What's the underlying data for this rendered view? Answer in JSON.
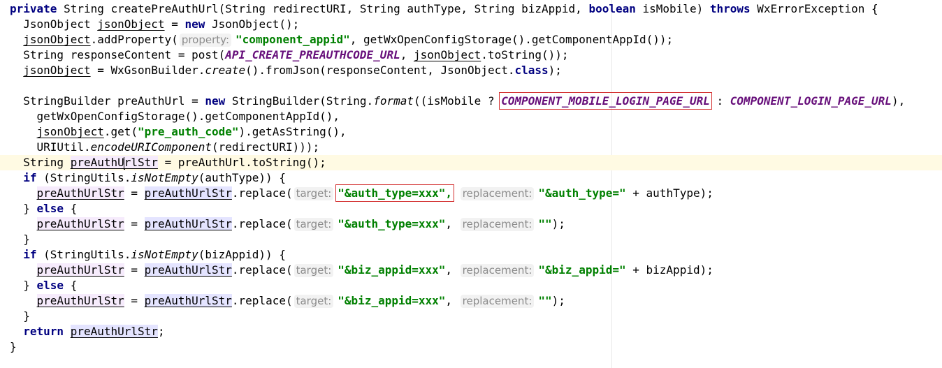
{
  "editor": {
    "lines": [
      {
        "indent": "",
        "segments": [
          {
            "t": "private",
            "c": "kw"
          },
          {
            "t": " String createPreAuthUrl(String redirectURI, String authType, String bizAppid, ",
            "c": "plain"
          },
          {
            "t": "boolean",
            "c": "kw"
          },
          {
            "t": " isMobile) ",
            "c": "plain"
          },
          {
            "t": "throws",
            "c": "kw"
          },
          {
            "t": " WxErrorException {",
            "c": "plain"
          }
        ]
      },
      {
        "indent": "  ",
        "segments": [
          {
            "t": "JsonObject ",
            "c": "plain"
          },
          {
            "t": "jsonObject",
            "c": "var-u"
          },
          {
            "t": " = ",
            "c": "plain"
          },
          {
            "t": "new",
            "c": "kw"
          },
          {
            "t": " JsonObject();",
            "c": "plain"
          }
        ]
      },
      {
        "indent": "  ",
        "segments": [
          {
            "t": "jsonObject",
            "c": "var-u"
          },
          {
            "t": ".addProperty(",
            "c": "plain"
          },
          {
            "t": "property:",
            "c": "hint"
          },
          {
            "t": "\"component_appid\"",
            "c": "str"
          },
          {
            "t": ", getWxOpenConfigStorage().getComponentAppId());",
            "c": "plain"
          }
        ]
      },
      {
        "indent": "  ",
        "segments": [
          {
            "t": "String responseContent = post(",
            "c": "plain"
          },
          {
            "t": "API_CREATE_PREAUTHCODE_URL",
            "c": "const"
          },
          {
            "t": ", ",
            "c": "plain"
          },
          {
            "t": "jsonObject",
            "c": "var-u"
          },
          {
            "t": ".toString());",
            "c": "plain"
          }
        ]
      },
      {
        "indent": "  ",
        "segments": [
          {
            "t": "jsonObject",
            "c": "var-u"
          },
          {
            "t": " = WxGsonBuilder.",
            "c": "plain"
          },
          {
            "t": "create",
            "c": "static"
          },
          {
            "t": "().fromJson(responseContent, JsonObject.",
            "c": "plain"
          },
          {
            "t": "class",
            "c": "kw"
          },
          {
            "t": ");",
            "c": "plain"
          }
        ]
      },
      {
        "indent": "",
        "segments": []
      },
      {
        "indent": "  ",
        "segments": [
          {
            "t": "StringBuilder preAuthUrl = ",
            "c": "plain"
          },
          {
            "t": "new",
            "c": "kw"
          },
          {
            "t": " StringBuilder(String.",
            "c": "plain"
          },
          {
            "t": "format",
            "c": "static"
          },
          {
            "t": "((isMobile ? ",
            "c": "plain"
          },
          {
            "t": "COMPONENT_MOBILE_LOGIN_PAGE_URL",
            "c": "const hl-box"
          },
          {
            "t": " : ",
            "c": "plain"
          },
          {
            "t": "COMPONENT_LOGIN_PAGE_URL",
            "c": "const"
          },
          {
            "t": "),",
            "c": "plain"
          }
        ]
      },
      {
        "indent": "    ",
        "segments": [
          {
            "t": "getWxOpenConfigStorage().getComponentAppId(),",
            "c": "plain"
          }
        ]
      },
      {
        "indent": "    ",
        "segments": [
          {
            "t": "jsonObject",
            "c": "var-u"
          },
          {
            "t": ".get(",
            "c": "plain"
          },
          {
            "t": "\"pre_auth_code\"",
            "c": "str"
          },
          {
            "t": ").getAsString(),",
            "c": "plain"
          }
        ]
      },
      {
        "indent": "    ",
        "segments": [
          {
            "t": "URIUtil.",
            "c": "plain"
          },
          {
            "t": "encodeURIComponent",
            "c": "static"
          },
          {
            "t": "(redirectURI)));",
            "c": "plain"
          }
        ]
      },
      {
        "indent": "  ",
        "current": true,
        "segments": [
          {
            "t": "String ",
            "c": "plain"
          },
          {
            "t": "preAuthU",
            "c": "var-u write"
          },
          {
            "t": "",
            "c": "caret"
          },
          {
            "t": "rlStr",
            "c": "var-u write"
          },
          {
            "t": " = preAuthUrl.toString();",
            "c": "plain"
          }
        ]
      },
      {
        "indent": "  ",
        "segments": [
          {
            "t": "if",
            "c": "kw"
          },
          {
            "t": " (StringUtils.",
            "c": "plain"
          },
          {
            "t": "isNotEmpty",
            "c": "static"
          },
          {
            "t": "(authType)) {",
            "c": "plain"
          }
        ]
      },
      {
        "indent": "    ",
        "segments": [
          {
            "t": "preAuthUrlStr",
            "c": "var-u write"
          },
          {
            "t": " = ",
            "c": "plain"
          },
          {
            "t": "preAuthUrlStr",
            "c": "var-u usage"
          },
          {
            "t": ".replace(",
            "c": "plain"
          },
          {
            "t": "target:",
            "c": "hint"
          },
          {
            "t": "\"&auth_type=xxx\",",
            "c": "str hl-box"
          },
          {
            "t": " ",
            "c": "plain"
          },
          {
            "t": "replacement:",
            "c": "hint"
          },
          {
            "t": "\"&auth_type=\"",
            "c": "str"
          },
          {
            "t": " + authType);",
            "c": "plain"
          }
        ]
      },
      {
        "indent": "  ",
        "segments": [
          {
            "t": "} ",
            "c": "plain"
          },
          {
            "t": "else",
            "c": "kw"
          },
          {
            "t": " {",
            "c": "plain"
          }
        ]
      },
      {
        "indent": "    ",
        "segments": [
          {
            "t": "preAuthUrlStr",
            "c": "var-u write"
          },
          {
            "t": " = ",
            "c": "plain"
          },
          {
            "t": "preAuthUrlStr",
            "c": "var-u usage"
          },
          {
            "t": ".replace(",
            "c": "plain"
          },
          {
            "t": "target:",
            "c": "hint"
          },
          {
            "t": "\"&auth_type=xxx\"",
            "c": "str"
          },
          {
            "t": ", ",
            "c": "plain"
          },
          {
            "t": "replacement:",
            "c": "hint"
          },
          {
            "t": "\"\"",
            "c": "str"
          },
          {
            "t": ");",
            "c": "plain"
          }
        ]
      },
      {
        "indent": "  ",
        "segments": [
          {
            "t": "}",
            "c": "plain"
          }
        ]
      },
      {
        "indent": "  ",
        "segments": [
          {
            "t": "if",
            "c": "kw"
          },
          {
            "t": " (StringUtils.",
            "c": "plain"
          },
          {
            "t": "isNotEmpty",
            "c": "static"
          },
          {
            "t": "(bizAppid)) {",
            "c": "plain"
          }
        ]
      },
      {
        "indent": "    ",
        "segments": [
          {
            "t": "preAuthUrlStr",
            "c": "var-u write"
          },
          {
            "t": " = ",
            "c": "plain"
          },
          {
            "t": "preAuthUrlStr",
            "c": "var-u usage"
          },
          {
            "t": ".replace(",
            "c": "plain"
          },
          {
            "t": "target:",
            "c": "hint"
          },
          {
            "t": "\"&biz_appid=xxx\"",
            "c": "str"
          },
          {
            "t": ", ",
            "c": "plain"
          },
          {
            "t": "replacement:",
            "c": "hint"
          },
          {
            "t": "\"&biz_appid=\"",
            "c": "str"
          },
          {
            "t": " + bizAppid);",
            "c": "plain"
          }
        ]
      },
      {
        "indent": "  ",
        "segments": [
          {
            "t": "} ",
            "c": "plain"
          },
          {
            "t": "else",
            "c": "kw"
          },
          {
            "t": " {",
            "c": "plain"
          }
        ]
      },
      {
        "indent": "    ",
        "segments": [
          {
            "t": "preAuthUrlStr",
            "c": "var-u write"
          },
          {
            "t": " = ",
            "c": "plain"
          },
          {
            "t": "preAuthUrlStr",
            "c": "var-u usage"
          },
          {
            "t": ".replace(",
            "c": "plain"
          },
          {
            "t": "target:",
            "c": "hint"
          },
          {
            "t": "\"&biz_appid=xxx\"",
            "c": "str"
          },
          {
            "t": ", ",
            "c": "plain"
          },
          {
            "t": "replacement:",
            "c": "hint"
          },
          {
            "t": "\"\"",
            "c": "str"
          },
          {
            "t": ");",
            "c": "plain"
          }
        ]
      },
      {
        "indent": "  ",
        "segments": [
          {
            "t": "}",
            "c": "plain"
          }
        ]
      },
      {
        "indent": "  ",
        "segments": [
          {
            "t": "return",
            "c": "kw"
          },
          {
            "t": " ",
            "c": "plain"
          },
          {
            "t": "preAuthUrlStr",
            "c": "var-u usage"
          },
          {
            "t": ";",
            "c": "plain"
          }
        ]
      },
      {
        "indent": "",
        "segments": [
          {
            "t": "}",
            "c": "plain"
          }
        ]
      }
    ]
  },
  "colors": {
    "keyword": "#000080",
    "string": "#008000",
    "constant": "#660e7a",
    "highlight_box": "#d32f2f",
    "current_line": "#fffae3"
  }
}
